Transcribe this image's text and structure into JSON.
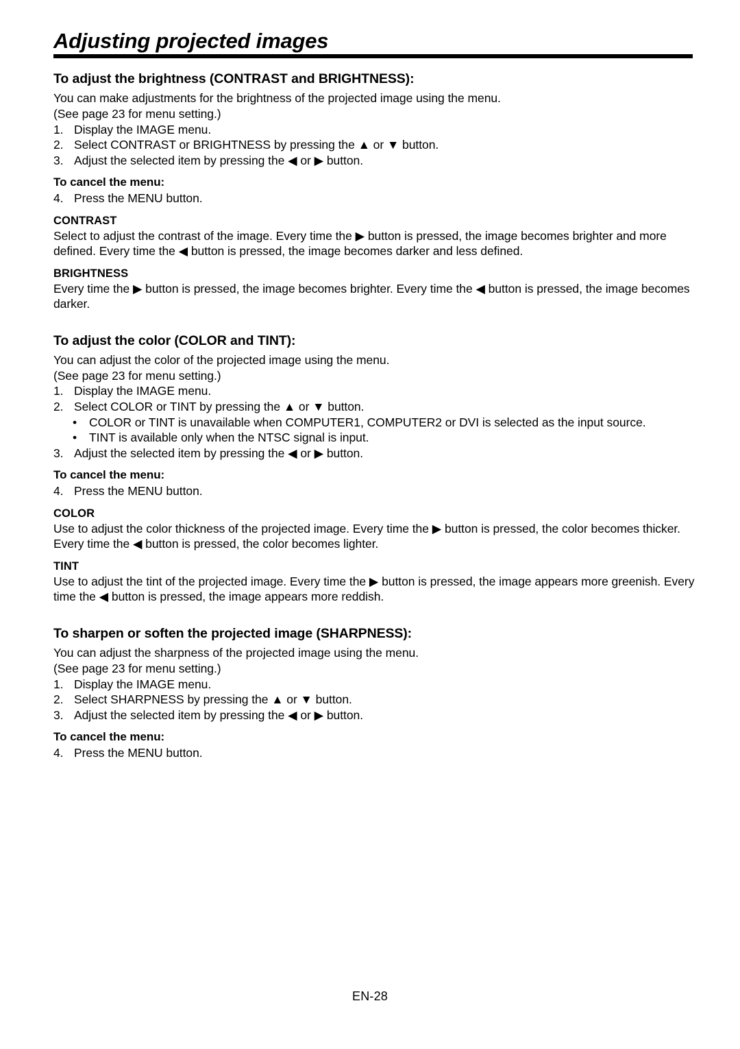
{
  "document": {
    "title": "Adjusting projected images",
    "footer_page": "EN-28"
  },
  "sections": [
    {
      "heading": "To adjust the brightness (CONTRAST and BRIGHTNESS):",
      "intro_1": "You can make adjustments for the brightness of the projected image using the menu.",
      "intro_2": "(See page 23 for menu setting.)",
      "steps": [
        {
          "num": "1.",
          "text": "Display the IMAGE menu."
        },
        {
          "num": "2.",
          "text": "Select CONTRAST or BRIGHTNESS by pressing the ▲ or ▼ button."
        },
        {
          "num": "3.",
          "text": "Adjust the selected item by pressing the ◀ or ▶ button."
        }
      ],
      "cancel_label": "To cancel the menu:",
      "cancel_step": {
        "num": "4.",
        "text": "Press the MENU button."
      },
      "subsections": [
        {
          "title": "CONTRAST",
          "body": "Select to adjust the contrast of the image. Every time the ▶ button is pressed, the image becomes brighter and more defined. Every time the ◀ button is pressed, the image becomes darker and less defined."
        },
        {
          "title": "BRIGHTNESS",
          "body": "Every time the ▶ button is pressed, the image becomes brighter. Every time the ◀ button is pressed, the image becomes darker."
        }
      ]
    },
    {
      "heading": "To adjust the color (COLOR and TINT):",
      "intro_1": "You can adjust the color of the projected image using the menu.",
      "intro_2": "(See page 23 for menu setting.)",
      "steps": [
        {
          "num": "1.",
          "text": "Display the IMAGE menu."
        },
        {
          "num": "2.",
          "text": "Select COLOR or TINT by pressing the ▲ or ▼ button."
        }
      ],
      "bullets": [
        "COLOR or TINT is unavailable when COMPUTER1, COMPUTER2 or DVI is selected as the input source.",
        "TINT is available only when the NTSC signal is input."
      ],
      "step_last": {
        "num": "3.",
        "text": "Adjust the selected item by pressing the ◀ or ▶ button."
      },
      "cancel_label": "To cancel the menu:",
      "cancel_step": {
        "num": "4.",
        "text": "Press the MENU button."
      },
      "subsections": [
        {
          "title": "COLOR",
          "body": "Use to adjust the color thickness of the projected image. Every time the ▶ button is pressed, the color becomes thicker. Every time the ◀ button is pressed, the color becomes lighter."
        },
        {
          "title": "TINT",
          "body": "Use to adjust the tint of the projected image. Every time the ▶ button is pressed, the image appears more greenish. Every time the ◀ button is pressed, the image appears more reddish."
        }
      ]
    },
    {
      "heading": "To sharpen or soften the projected image (SHARPNESS):",
      "intro_1": "You can adjust the sharpness of the projected image using the menu.",
      "intro_2": "(See page 23 for menu setting.)",
      "steps": [
        {
          "num": "1.",
          "text": "Display the IMAGE menu."
        },
        {
          "num": "2.",
          "text": "Select SHARPNESS by pressing the ▲ or ▼ button."
        },
        {
          "num": "3.",
          "text": "Adjust the selected item by pressing the ◀ or ▶ button."
        }
      ],
      "cancel_label": "To cancel the menu:",
      "cancel_step": {
        "num": "4.",
        "text": "Press the MENU button."
      }
    }
  ],
  "bullet_glyph": "•"
}
